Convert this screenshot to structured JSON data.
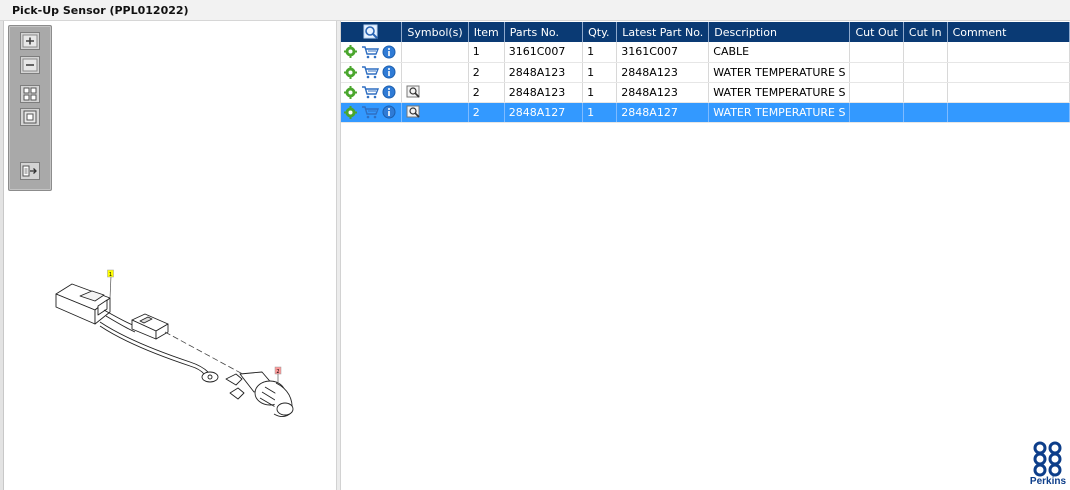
{
  "window": {
    "title": "Pick-Up Sensor (PPL012022)"
  },
  "toolbar": {
    "zoom_in": "zoom-in",
    "zoom_out": "zoom-out",
    "fit_all": "fit-all",
    "fit_window": "fit-window",
    "export": "export"
  },
  "diagram": {
    "callouts": [
      "1",
      "2"
    ],
    "callout_colors": {
      "1": "#ffff00",
      "2": "#ff9999"
    }
  },
  "table": {
    "headers": [
      "",
      "Symbol(s)",
      "Item",
      "Parts No.",
      "Qty.",
      "Latest Part No.",
      "Description",
      "Cut Out",
      "Cut In",
      "Comment"
    ],
    "rows": [
      {
        "symbol": "",
        "item": "1",
        "parts_no": "3161C007",
        "qty": "1",
        "latest_part_no": "3161C007",
        "description": "CABLE",
        "cut_out": "",
        "cut_in": "",
        "comment": "",
        "selected": false
      },
      {
        "symbol": "",
        "item": "2",
        "parts_no": "2848A123",
        "qty": "1",
        "latest_part_no": "2848A123",
        "description": "WATER TEMPERATURE S",
        "cut_out": "",
        "cut_in": "",
        "comment": "",
        "selected": false
      },
      {
        "symbol": "view-icon",
        "item": "2",
        "parts_no": "2848A123",
        "qty": "1",
        "latest_part_no": "2848A123",
        "description": "WATER TEMPERATURE S",
        "cut_out": "",
        "cut_in": "",
        "comment": "",
        "selected": false
      },
      {
        "symbol": "view-icon",
        "item": "2",
        "parts_no": "2848A127",
        "qty": "1",
        "latest_part_no": "2848A127",
        "description": "WATER TEMPERATURE S",
        "cut_out": "",
        "cut_in": "",
        "comment": "",
        "selected": true
      }
    ]
  },
  "logo": {
    "brand": "Perkins",
    "color": "#0d3e8a"
  },
  "colors": {
    "header_bg": "#0a3a74",
    "selected_row": "#3399ff",
    "toolbar_bg": "#a9a9a9"
  }
}
